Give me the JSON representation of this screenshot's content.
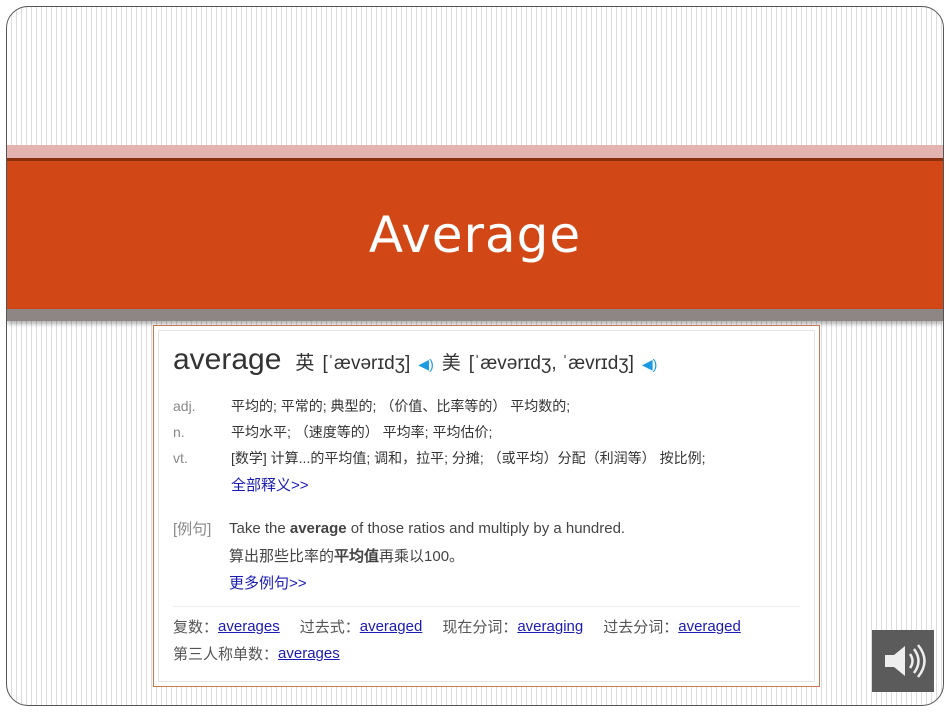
{
  "slide": {
    "title": "Average"
  },
  "entry": {
    "word": "average",
    "uk_label": "英",
    "uk_phonetic": "[ˈævərɪdʒ]",
    "us_label": "美",
    "us_phonetic": "[ˈævərɪdʒ, ˈævrɪdʒ]",
    "definitions": [
      {
        "pos": "adj.",
        "text": "平均的; 平常的; 典型的; （价值、比率等的） 平均数的;"
      },
      {
        "pos": "n.",
        "text": "平均水平; （速度等的） 平均率; 平均估价;"
      },
      {
        "pos": "vt.",
        "text": "[数学] 计算...的平均值; 调和，拉平; 分摊; （或平均）分配（利润等） 按比例;"
      }
    ],
    "all_defs_link": "全部释义>>",
    "example": {
      "label": "[例句]",
      "en_pre": "Take the ",
      "en_bold": "average",
      "en_post": " of those ratios and multiply by a hundred.",
      "zh_pre": "算出那些比率的",
      "zh_bold": "平均值",
      "zh_post": "再乘以100。"
    },
    "more_examples_link": "更多例句>>",
    "forms": [
      {
        "label": "复数：",
        "value": "averages"
      },
      {
        "label": "过去式：",
        "value": "averaged"
      },
      {
        "label": "现在分词：",
        "value": "averaging"
      },
      {
        "label": "过去分词：",
        "value": "averaged"
      },
      {
        "label": "第三人称单数：",
        "value": "averages"
      }
    ]
  },
  "colors": {
    "band": "#d24716",
    "link": "#1a1ab5",
    "speaker": "#1a9ae0"
  }
}
